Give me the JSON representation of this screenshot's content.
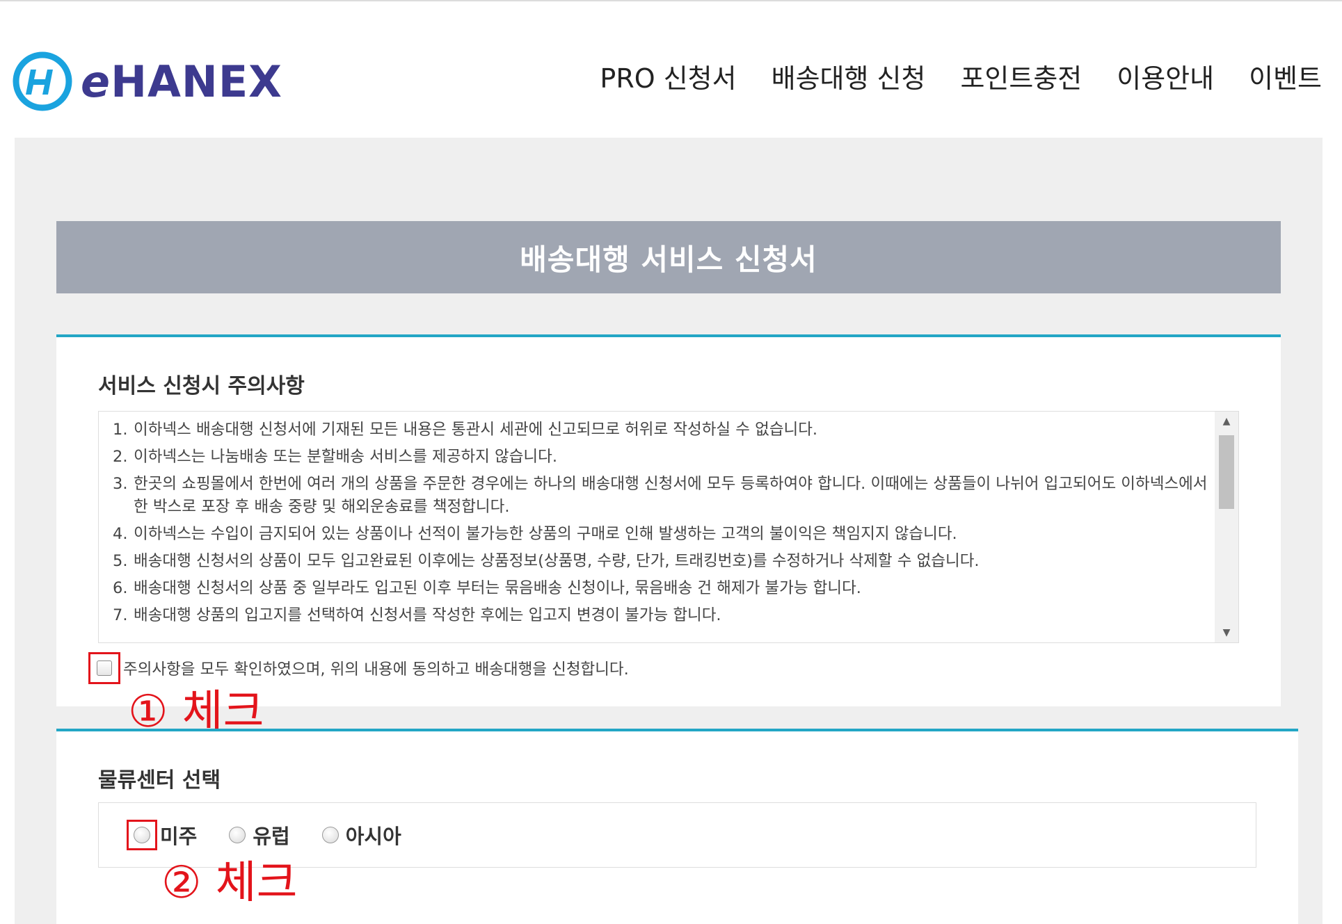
{
  "logo": {
    "text_e": "e",
    "text_rest": "HANEX"
  },
  "nav": [
    {
      "label": "PRO 신청서"
    },
    {
      "label": "배송대행 신청"
    },
    {
      "label": "포인트충전"
    },
    {
      "label": "이용안내"
    },
    {
      "label": "이벤트"
    }
  ],
  "title": "배송대행 서비스 신청서",
  "notice_section": {
    "heading": "서비스 신청시 주의사항",
    "items": [
      {
        "num": "1.",
        "text": "이하넥스 배송대행 신청서에 기재된 모든 내용은 통관시 세관에 신고되므로 허위로 작성하실 수 없습니다."
      },
      {
        "num": "2.",
        "text": "이하넥스는 나눔배송 또는 분할배송 서비스를 제공하지 않습니다."
      },
      {
        "num": "3.",
        "text": "한곳의 쇼핑몰에서 한번에 여러 개의 상품을 주문한 경우에는 하나의 배송대행 신청서에 모두 등록하여야 합니다. 이때에는 상품들이 나뉘어 입고되어도 이하넥스에서 한 박스로 포장 후 배송 중량 및 해외운송료를 책정합니다."
      },
      {
        "num": "4.",
        "text": "이하넥스는 수입이 금지되어 있는 상품이나 선적이 불가능한 상품의 구매로 인해 발생하는 고객의 불이익은 책임지지 않습니다."
      },
      {
        "num": "5.",
        "text": "배송대행 신청서의 상품이 모두 입고완료된 이후에는 상품정보(상품명, 수량, 단가, 트래킹번호)를 수정하거나 삭제할 수 없습니다."
      },
      {
        "num": "6.",
        "text": "배송대행 신청서의 상품 중 일부라도 입고된 이후 부터는 묶음배송 신청이나, 묶음배송 건 해제가 불가능 합니다."
      },
      {
        "num": "7.",
        "text": "배송대행 상품의 입고지를 선택하여 신청서를 작성한 후에는 입고지 변경이 불가능 합니다."
      }
    ],
    "agree_label": "주의사항을 모두 확인하였으며, 위의 내용에 동의하고 배송대행을 신청합니다.",
    "agree_checked": false
  },
  "annotations": {
    "first": "① 체크",
    "second": "② 체크"
  },
  "center_section": {
    "heading": "물류센터 선택",
    "options": [
      {
        "label": "미주"
      },
      {
        "label": "유럽"
      },
      {
        "label": "아시아"
      }
    ],
    "selected": null
  },
  "colors": {
    "accent": "#23a6c5",
    "title_bar": "#a0a6b2",
    "annotation": "#e3141b",
    "logo_blue": "#1aa3df",
    "logo_text": "#3d3a8f"
  },
  "icons": [
    "logo-h-icon",
    "scroll-up-icon",
    "scroll-down-icon"
  ]
}
